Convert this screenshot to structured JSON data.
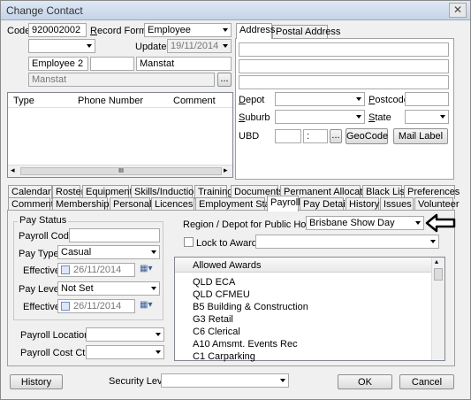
{
  "window": {
    "title": "Change Contact",
    "close_glyph": "✕"
  },
  "top": {
    "code_label": "Code",
    "code_value": "920002002",
    "record_format_label": "Record Format",
    "record_format_value": "Employee",
    "updated_label": "Updated",
    "updated_value": "19/11/2014",
    "first_name": "Employee 2",
    "middle_name": "",
    "last_name": "Manstat",
    "display_name": "Manstat",
    "ellipsis": "..."
  },
  "phones": {
    "columns": [
      "Type",
      "Phone Number",
      "Comment"
    ],
    "hscroll_thumb": "III"
  },
  "address": {
    "tabs": [
      "Address",
      "Postal Address"
    ],
    "depot_label": "Depot",
    "postcode_label": "Postcode",
    "suburb_label": "Suburb",
    "state_label": "State",
    "ubd_label": "UBD",
    "ubd_sep": ":",
    "ellipsis": "...",
    "geocode_btn": "GeoCode",
    "mail_label_btn": "Mail Label"
  },
  "tabs_row1": [
    "Calendar",
    "Roster",
    "Equipment",
    "Skills/Inductions",
    "Training",
    "Documents",
    "Permanent Allocations",
    "Black List",
    "Preferences"
  ],
  "tabs_row2": [
    "Comments",
    "Memberships",
    "Personal",
    "Licences",
    "Employment Status",
    "Payroll",
    "Pay Details",
    "History",
    "Issues",
    "Volunteer"
  ],
  "active_tab": "Payroll",
  "payroll": {
    "pay_status_label": "Pay Status",
    "payroll_code_label": "Payroll Code",
    "payroll_code_value": "",
    "pay_type_label": "Pay Type",
    "pay_type_value": "Casual",
    "effective_label": "Effective",
    "effective1_value": "26/11/2014",
    "pay_level_label": "Pay Level",
    "pay_level_value": "Not Set",
    "effective2_value": "26/11/2014",
    "payroll_location_label": "Payroll Location",
    "payroll_cost_ctr_label": "Payroll Cost Ctr",
    "region_label": "Region / Depot for Public Holidays",
    "region_value": "Brisbane Show Day",
    "lock_award_label": "Lock to Award",
    "awards_header": "Allowed Awards",
    "awards": [
      "QLD ECA",
      "QLD CFMEU",
      "B5 Building & Construction",
      "G3 Retail",
      "C6 Clerical",
      "A10 Amsmt. Events Rec",
      "C1 Carparking"
    ]
  },
  "bottom": {
    "history_btn": "History",
    "security_label": "Security Level",
    "ok_btn": "OK",
    "cancel_btn": "Cancel"
  }
}
